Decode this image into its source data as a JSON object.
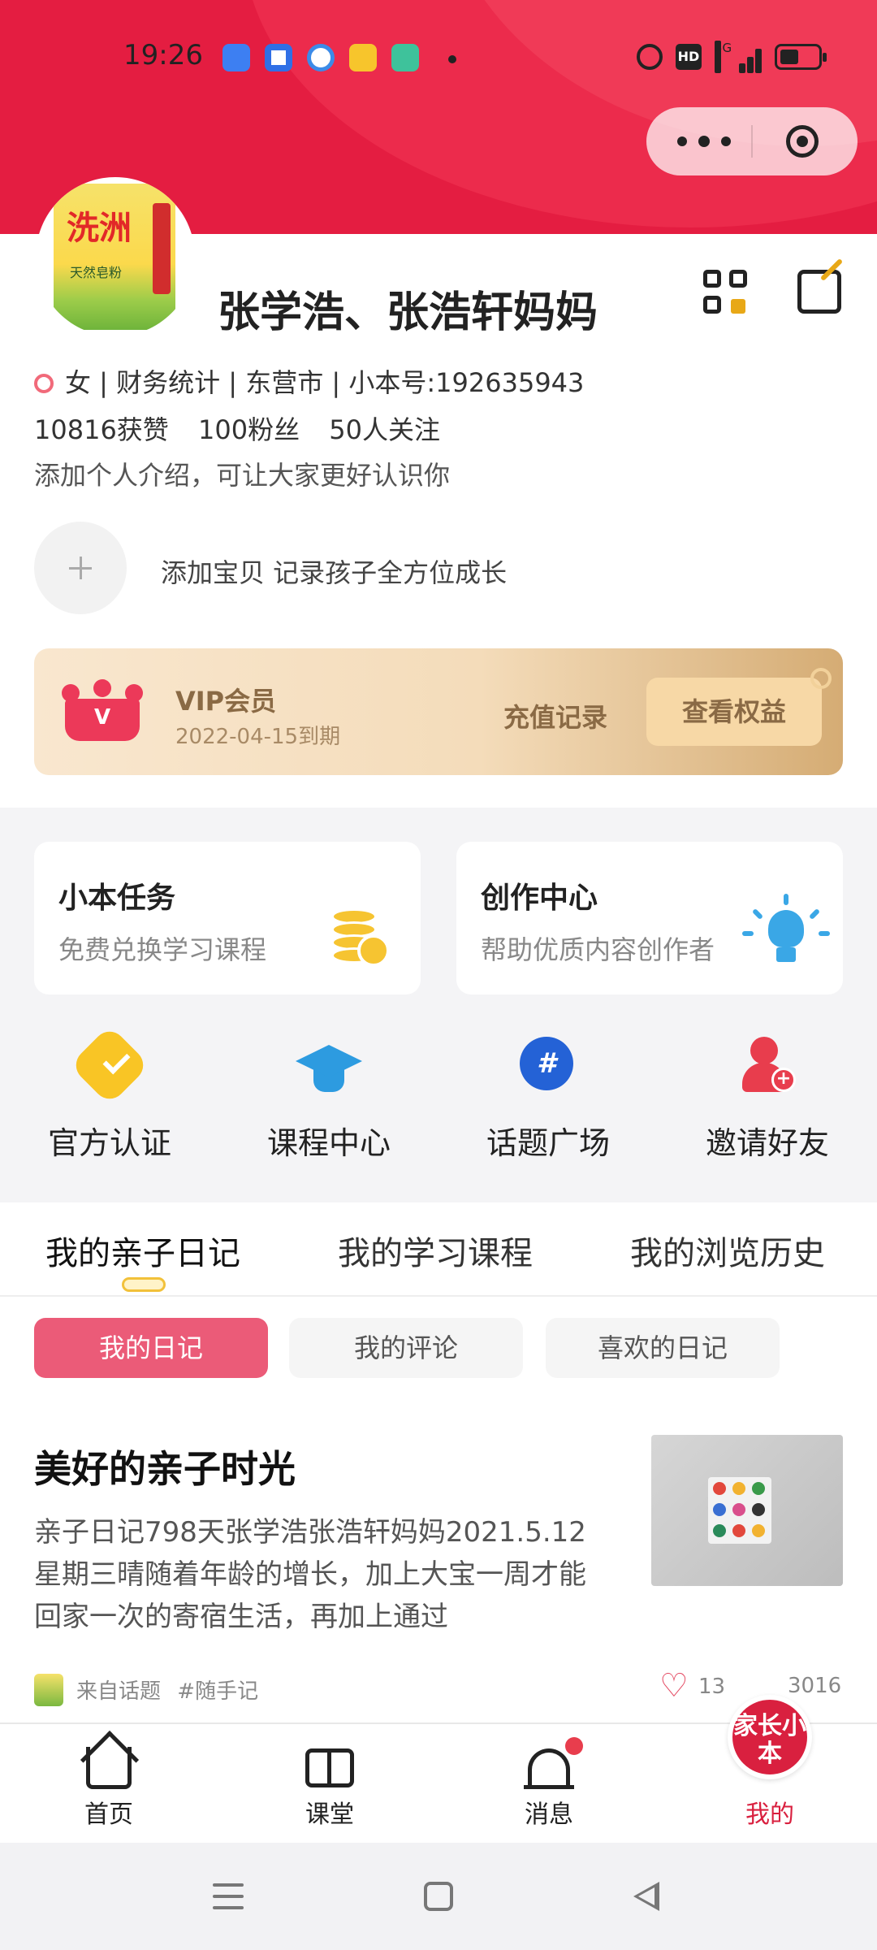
{
  "status_bar": {
    "time": "19:26",
    "hd": "HD",
    "network": "5G",
    "icons": [
      "app-icon-blue",
      "app-icon-circle",
      "app-icon-browser",
      "app-icon-yellow",
      "app-icon-green",
      "alarm-icon",
      "hd-icon",
      "signal-icon",
      "battery-icon"
    ]
  },
  "profile": {
    "name": "张学浩、张浩轩妈妈",
    "info": "女 | 财务统计 | 东营市 | 小本号:192635943",
    "stats": {
      "likes": "10816获赞",
      "fans": "100粉丝",
      "following": "50人关注"
    },
    "bio": "添加个人介绍，可让大家更好认识你",
    "add_baby_text": "添加宝贝 记录孩子全方位成长",
    "avatar_brand": "洗洲",
    "avatar_sub": "天然皂粉"
  },
  "vip": {
    "title": "VIP会员",
    "expire": "2022-04-15到期",
    "recharge_label": "充值记录",
    "rights_button": "查看权益",
    "badge_letter": "V"
  },
  "cards": [
    {
      "title": "小本任务",
      "subtitle": "免费兑换学习课程"
    },
    {
      "title": "创作中心",
      "subtitle": "帮助优质内容创作者"
    }
  ],
  "quick_actions": [
    {
      "label": "官方认证",
      "icon": "verified-badge-icon"
    },
    {
      "label": "课程中心",
      "icon": "graduation-cap-icon"
    },
    {
      "label": "话题广场",
      "icon": "hashtag-icon"
    },
    {
      "label": "邀请好友",
      "icon": "invite-friend-icon"
    }
  ],
  "tabs": [
    {
      "label": "我的亲子日记",
      "active": true
    },
    {
      "label": "我的学习课程",
      "active": false
    },
    {
      "label": "我的浏览历史",
      "active": false
    }
  ],
  "chips": [
    {
      "label": "我的日记",
      "active": true
    },
    {
      "label": "我的评论",
      "active": false
    },
    {
      "label": "喜欢的日记",
      "active": false
    }
  ],
  "post": {
    "title": "美好的亲子时光",
    "body": "亲子日记798天张学浩张浩轩妈妈2021.5.12星期三晴随着年龄的增长，加上大宝一周才能回家一次的寄宿生活，再加上通过",
    "source": "来自话题",
    "topic": "#随手记",
    "likes": "13",
    "views": "3016"
  },
  "nav": {
    "items": [
      {
        "label": "首页",
        "icon": "home-icon"
      },
      {
        "label": "课堂",
        "icon": "book-icon"
      },
      {
        "label": "消息",
        "icon": "bell-icon"
      }
    ],
    "mine_logo": "家长小本",
    "mine_label": "我的"
  },
  "colors": {
    "header_red": "#e41d41",
    "accent_pink": "#eb5b78",
    "vip_brown": "#8a6a45",
    "mine_red": "#d9203f"
  }
}
